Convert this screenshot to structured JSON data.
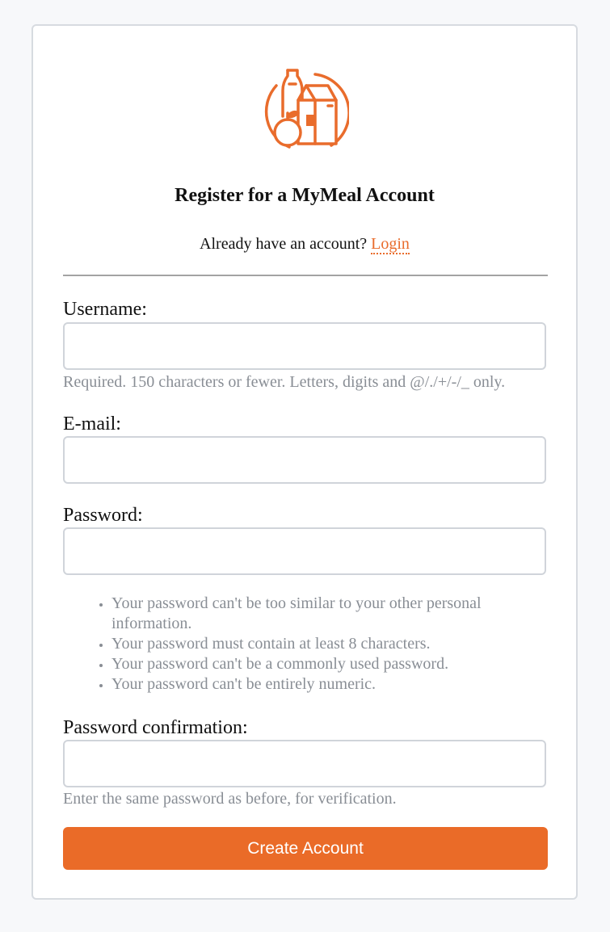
{
  "header": {
    "logo_icon": "groceries-icon",
    "brand_color": "#e96c2c",
    "title": "Register for a MyMeal Account",
    "login_prompt": "Already have an account?",
    "login_link": "Login"
  },
  "form": {
    "username": {
      "label": "Username:",
      "value": "",
      "help": "Required. 150 characters or fewer. Letters, digits and @/./+/-/_ only."
    },
    "email": {
      "label": "E-mail:",
      "value": ""
    },
    "password": {
      "label": "Password:",
      "value": "",
      "rules": [
        "Your password can't be too similar to your other personal information.",
        "Your password must contain at least 8 characters.",
        "Your password can't be a commonly used password.",
        "Your password can't be entirely numeric."
      ]
    },
    "password_confirmation": {
      "label": "Password confirmation:",
      "value": "",
      "help": "Enter the same password as before, for verification."
    },
    "submit_label": "Create Account",
    "submit_color": "#ea6b28"
  }
}
